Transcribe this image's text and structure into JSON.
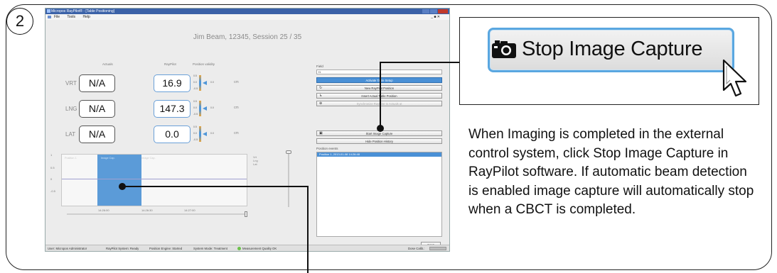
{
  "step_number": "2",
  "window": {
    "title": "Micropos RayPilot® - [Table Positioning]",
    "menu": [
      "File",
      "Tools",
      "Help"
    ],
    "window_controls": "_ ■ ✕",
    "session_title": "Jim Beam, 12345, Session 25 / 35"
  },
  "positions": {
    "headers": {
      "actuals": "Actuals",
      "raypilot": "RayPilot",
      "validity": "Position validity"
    },
    "rows": [
      {
        "label": "VRT",
        "actual": "N/A",
        "raypilot": "16.9",
        "gauge": "0.0",
        "unit": "cm"
      },
      {
        "label": "LNG",
        "actual": "N/A",
        "raypilot": "147.3",
        "gauge": "0.0",
        "unit": "cm"
      },
      {
        "label": "LAT",
        "actual": "N/A",
        "raypilot": "0.0",
        "gauge": "0.0",
        "unit": "cm"
      }
    ],
    "gauge_ticks": [
      "0.5",
      "0.0",
      "-0.5"
    ]
  },
  "chart": {
    "y_ticks": [
      "1",
      "0.5",
      "0",
      "-0.5"
    ],
    "x_ticks": [
      "14:26:00",
      "14:26:30",
      "14:27:00"
    ],
    "segments": [
      "Position 1",
      "Image Cap.",
      "Image Cap."
    ],
    "legend": [
      "Vrt",
      "Lng",
      "Lat"
    ]
  },
  "right_panel": {
    "field_label": "Field",
    "field_value": "f1",
    "buttons": {
      "activate": "Activate Table Setup",
      "new_position": "New RayPilot Position",
      "insert_actual": "Insert Actual Table Position",
      "synchronize": "Synchronize RayPilot to Actuals at",
      "start_capture": "Start Image Capture",
      "hide_history": "Hide Position History"
    },
    "events_label": "Position events",
    "events": [
      "Position 1, 2013-01-08 14:26:48"
    ],
    "next_label": "Next"
  },
  "status_bar": {
    "user": "User: Micropos Administrator",
    "system": "RayPilot System: Ready",
    "engine": "Position Engine: Started",
    "mode": "System Mode: Treatment",
    "quality": "Measurement Quality OK",
    "dose": "Dose Calib.:"
  },
  "callout": {
    "button_label": "Stop Image Capture",
    "icons": [
      "camera-icon",
      "mouse-pointer-icon"
    ]
  },
  "description": "When Imaging is completed in the external control system, click Stop Image Capture in RayPilot software. If automatic beam detection is enabled image capture will automatically stop when a CBCT is completed.",
  "colors": {
    "accent": "#5aa7e0",
    "selection": "#5b9bd8",
    "titlebar": "#3b62a8"
  }
}
